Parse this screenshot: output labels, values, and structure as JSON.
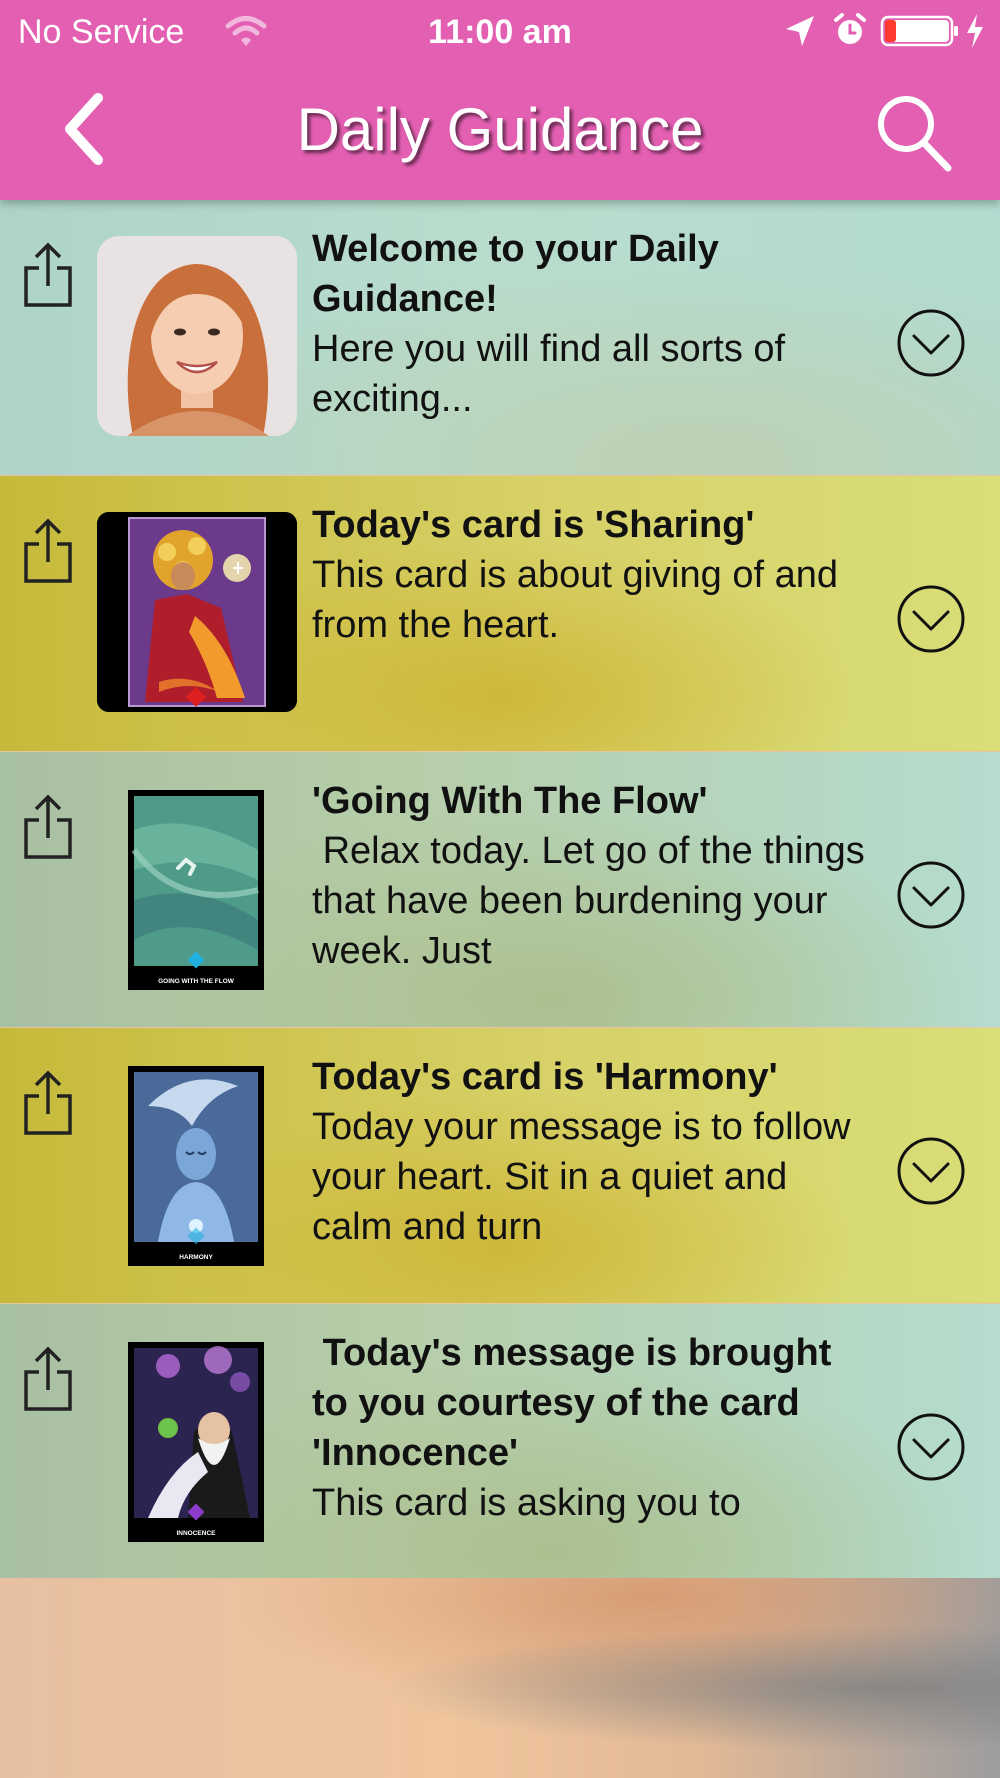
{
  "status_bar": {
    "carrier": "No Service",
    "time": "11:00 am"
  },
  "header": {
    "title": "Daily Guidance",
    "back_icon": "chevron-left-icon",
    "search_icon": "search-icon"
  },
  "colors": {
    "header": "#e35fb1",
    "battery_low": "#ff3b30"
  },
  "feed": {
    "items": [
      {
        "title": "Welcome to your Daily Guidance!",
        "body": "Here you will find all sorts of exciting...",
        "image": "author-portrait"
      },
      {
        "title": "Today's card is 'Sharing'",
        "body": "This card is about giving of and from the heart.",
        "image": "sharing-card"
      },
      {
        "title": "'Going With The Flow'",
        "body": " Relax today. Let go of the things that have been burdening your week. Just",
        "image": "going-with-the-flow-card",
        "card_caption": "GOING WITH THE FLOW"
      },
      {
        "title": "Today's card is 'Harmony'",
        "body": "Today your message is to follow your heart. Sit in a quiet and calm and turn",
        "image": "harmony-card",
        "card_caption": "HARMONY"
      },
      {
        "title": " Today's message is brought to you courtesy of the card 'Innocence'",
        "body": "This card is asking you to",
        "image": "innocence-card",
        "card_caption": "INNOCENCE"
      }
    ]
  }
}
